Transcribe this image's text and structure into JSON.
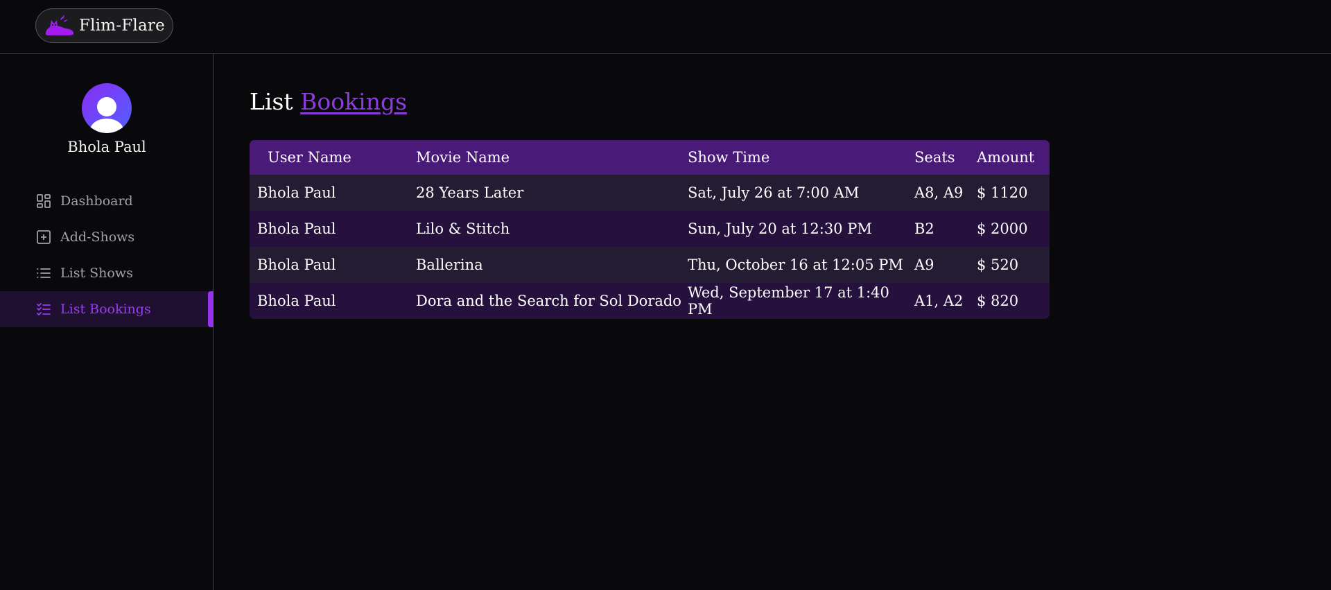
{
  "app": {
    "brand": "Flim-Flare",
    "accent_color": "#9333ea"
  },
  "sidebar": {
    "user_name": "Bhola Paul",
    "items": [
      {
        "label": "Dashboard",
        "icon": "dashboard-grid-icon",
        "active": false
      },
      {
        "label": "Add-Shows",
        "icon": "plus-square-icon",
        "active": false
      },
      {
        "label": "List Shows",
        "icon": "list-icon",
        "active": false
      },
      {
        "label": "List Bookings",
        "icon": "list-checks-icon",
        "active": true
      }
    ]
  },
  "main": {
    "title_prefix": "List",
    "title_accent": "Bookings",
    "table": {
      "columns": [
        "User Name",
        "Movie Name",
        "Show Time",
        "Seats",
        "Amount"
      ],
      "rows": [
        [
          "Bhola Paul",
          "28 Years Later",
          "Sat, July 26 at 7:00 AM",
          "A8, A9",
          "$ 1120"
        ],
        [
          "Bhola Paul",
          "Lilo & Stitch",
          "Sun, July 20 at 12:30 PM",
          "B2",
          "$ 2000"
        ],
        [
          "Bhola Paul",
          "Ballerina",
          "Thu, October 16 at 12:05 PM",
          "A9",
          "$ 520"
        ],
        [
          "Bhola Paul",
          "Dora and the Search for Sol Dorado",
          "Wed, September 17 at 1:40 PM",
          "A1, A2",
          "$ 820"
        ]
      ]
    }
  }
}
